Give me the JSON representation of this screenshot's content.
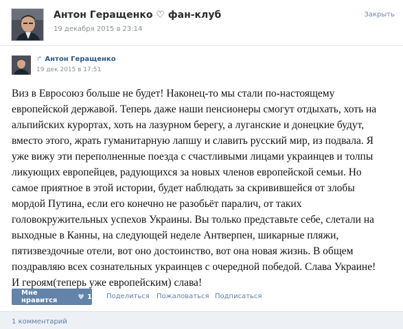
{
  "header": {
    "title": "Антон Геращенко ♡ фан-клуб",
    "date": "19 декабря 2015 в 23:14",
    "close_label": "Закрыть"
  },
  "repost": {
    "author": "Антон Геращенко",
    "share_icon": "share-arrow-icon",
    "date": "19 дек 2015 в 17:51"
  },
  "post": {
    "lines": [
      "Виз в Евросоюз больше не будет! Наконец-то мы стали по-настоящему",
      "европейской державой. Теперь даже наши пенсионеры смогут отдыхать, хоть на",
      "альпийских курортах, хоть на лазурном берегу, а луганские и донецкие будут,",
      "вместо этого, жрать гуманитарную лапшу и славить русский мир, из подвала. Я",
      "уже вижу эти переполненные поезда с счастливыми лицами украинцев и толпы",
      "ликующих европейцев, радующихся за новых членов европейской семьи. Но",
      "самое приятное в этой истории, будет наблюдать за скривившейся от злобы",
      "мордой Путина, если его конечно не разобьёт паралич, от таких",
      "головокружительных успехов Украины. Вы только представьте себе, слетали на",
      "выходные в Канны, на следующей неделе Антверпен, шикарные пляжи,",
      "пятизвездочные отели, вот оно достоинство, вот она новая жизнь. В общем",
      "поздравляю всех сознательных украинцев с очередной победой. Слава Украине!",
      "И героям(теперь уже европейским) слава!"
    ]
  },
  "actions": {
    "like_label": "Мне нравится",
    "like_count": "1",
    "share_label": "Поделиться",
    "complain_label": "Пожаловаться",
    "subscribe_label": "Подписаться"
  },
  "comments": {
    "count_label": "1 комментарий"
  },
  "colors": {
    "accent": "#6383a8",
    "link": "#2a5885",
    "background": "#dfe4ea"
  }
}
